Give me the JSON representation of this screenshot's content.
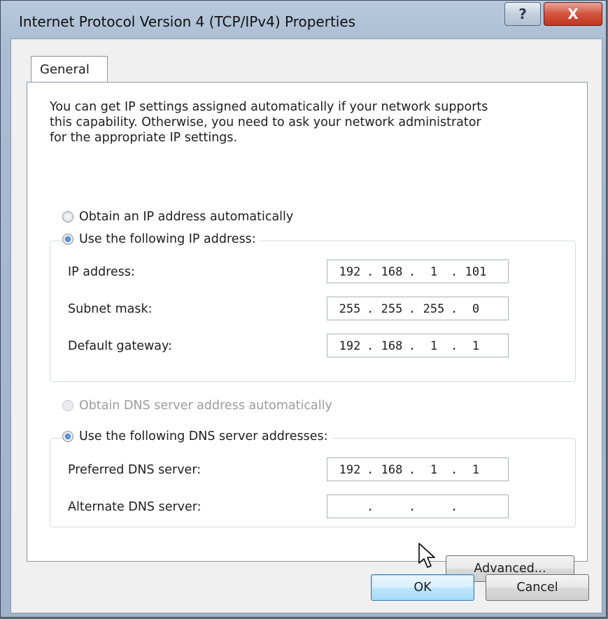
{
  "window": {
    "title": "Internet Protocol Version 4 (TCP/IPv4) Properties",
    "help_label": "?",
    "close_label": "X"
  },
  "tabs": [
    {
      "label": "General"
    }
  ],
  "intro": {
    "line1": "You can get IP settings assigned automatically if your network supports",
    "line2": "this capability. Otherwise, you need to ask your network administrator",
    "line3": "for the appropriate IP settings."
  },
  "ip_section": {
    "auto_label": "Obtain an IP address automatically",
    "manual_label": "Use the following IP address:",
    "selected": "manual",
    "fields": [
      {
        "label": "IP address:",
        "octets": [
          "192",
          "168",
          "1",
          "101"
        ]
      },
      {
        "label": "Subnet mask:",
        "octets": [
          "255",
          "255",
          "255",
          "0"
        ]
      },
      {
        "label": "Default gateway:",
        "octets": [
          "192",
          "168",
          "1",
          "1"
        ]
      }
    ]
  },
  "dns_section": {
    "auto_label": "Obtain DNS server address automatically",
    "auto_disabled": true,
    "manual_label": "Use the following DNS server addresses:",
    "selected": "manual",
    "fields": [
      {
        "label": "Preferred DNS server:",
        "octets": [
          "192",
          "168",
          "1",
          "1"
        ]
      },
      {
        "label": "Alternate DNS server:",
        "octets": [
          "",
          "",
          "",
          ""
        ]
      }
    ]
  },
  "buttons": {
    "advanced": "Advanced...",
    "ok": "OK",
    "cancel": "Cancel"
  },
  "ip_separator": "."
}
